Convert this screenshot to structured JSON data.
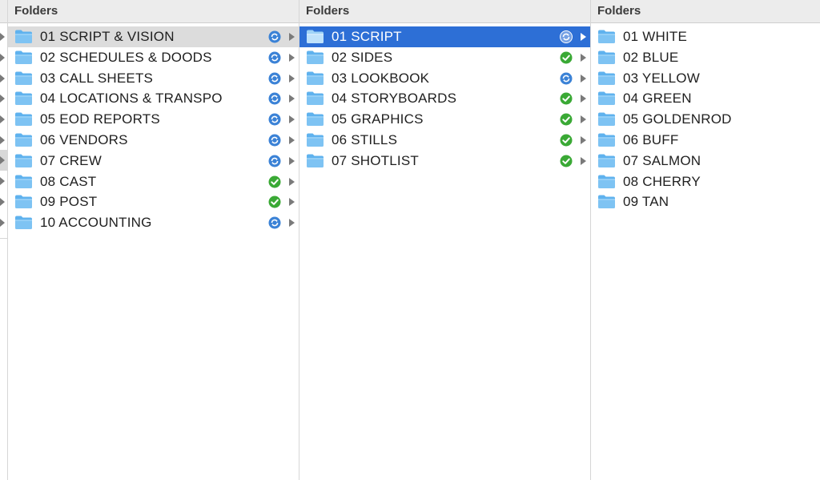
{
  "colors": {
    "sync_blue": "#3b82d6",
    "synced_green": "#3aa935",
    "selection_blue": "#2d6fd6",
    "selection_gray": "#dcdcdc",
    "folder_blue": "#7ec3f3"
  },
  "columns": [
    {
      "header": "Folders",
      "items": [
        {
          "label": "01 SCRIPT & VISION",
          "status": "syncing",
          "selected": "gray",
          "has_children": true
        },
        {
          "label": "02 SCHEDULES & DOODS",
          "status": "syncing",
          "has_children": true
        },
        {
          "label": "03 CALL SHEETS",
          "status": "syncing",
          "has_children": true
        },
        {
          "label": "04 LOCATIONS & TRANSPO",
          "status": "syncing",
          "has_children": true
        },
        {
          "label": "05 EOD REPORTS",
          "status": "syncing",
          "has_children": true
        },
        {
          "label": "06 VENDORS",
          "status": "syncing",
          "has_children": true
        },
        {
          "label": "07 CREW",
          "status": "syncing",
          "has_children": true
        },
        {
          "label": "08 CAST",
          "status": "synced",
          "has_children": true
        },
        {
          "label": "09 POST",
          "status": "synced",
          "has_children": true
        },
        {
          "label": "10 ACCOUNTING",
          "status": "syncing",
          "has_children": true
        }
      ]
    },
    {
      "header": "Folders",
      "items": [
        {
          "label": "01 SCRIPT",
          "status": "syncing",
          "selected": "blue",
          "has_children": true
        },
        {
          "label": "02 SIDES",
          "status": "synced",
          "has_children": true
        },
        {
          "label": "03 LOOKBOOK",
          "status": "syncing",
          "has_children": true
        },
        {
          "label": "04 STORYBOARDS",
          "status": "synced",
          "has_children": true
        },
        {
          "label": "05 GRAPHICS",
          "status": "synced",
          "has_children": true
        },
        {
          "label": "06 STILLS",
          "status": "synced",
          "has_children": true
        },
        {
          "label": "07 SHOTLIST",
          "status": "synced",
          "has_children": true
        }
      ]
    },
    {
      "header": "Folders",
      "items": [
        {
          "label": "01 WHITE",
          "status": "none",
          "has_children": false
        },
        {
          "label": "02 BLUE",
          "status": "none",
          "has_children": false
        },
        {
          "label": "03 YELLOW",
          "status": "none",
          "has_children": false
        },
        {
          "label": "04 GREEN",
          "status": "none",
          "has_children": false
        },
        {
          "label": "05 GOLDENROD",
          "status": "none",
          "has_children": false
        },
        {
          "label": "06 BUFF",
          "status": "none",
          "has_children": false
        },
        {
          "label": "07 SALMON",
          "status": "none",
          "has_children": false
        },
        {
          "label": "08 CHERRY",
          "status": "none",
          "has_children": false
        },
        {
          "label": "09 TAN",
          "status": "none",
          "has_children": false
        }
      ]
    }
  ]
}
